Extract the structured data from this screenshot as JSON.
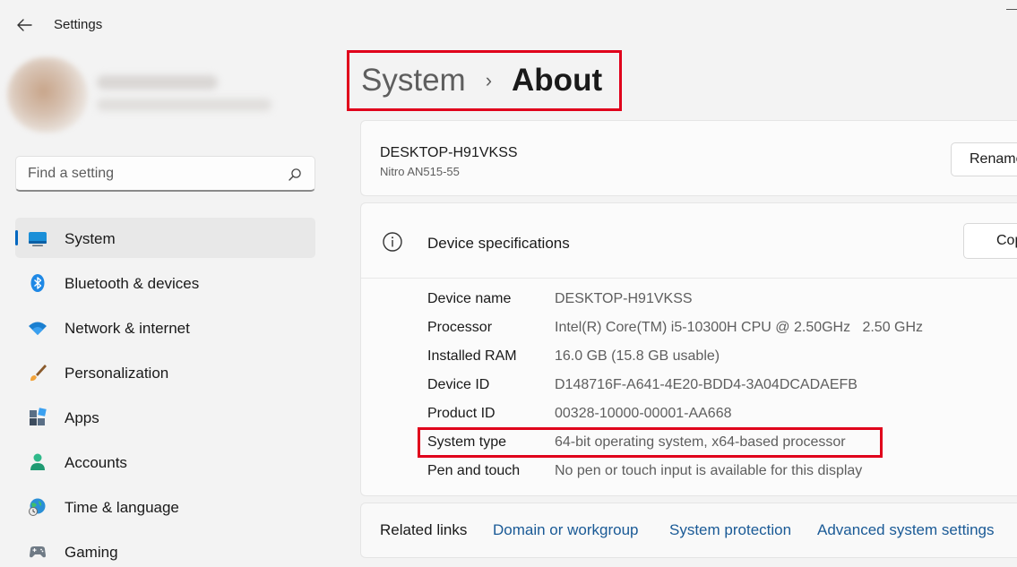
{
  "window": {
    "title": "Settings"
  },
  "search": {
    "placeholder": "Find a setting"
  },
  "nav": {
    "items": [
      {
        "label": "System"
      },
      {
        "label": "Bluetooth & devices"
      },
      {
        "label": "Network & internet"
      },
      {
        "label": "Personalization"
      },
      {
        "label": "Apps"
      },
      {
        "label": "Accounts"
      },
      {
        "label": "Time & language"
      },
      {
        "label": "Gaming"
      }
    ]
  },
  "breadcrumb": {
    "parent": "System",
    "separator": "›",
    "current": "About"
  },
  "device": {
    "name": "DESKTOP-H91VKSS",
    "model": "Nitro AN515-55",
    "rename_label": "Rename"
  },
  "specs": {
    "title": "Device specifications",
    "copy_label": "Copy",
    "rows": [
      {
        "key": "Device name",
        "value": "DESKTOP-H91VKSS"
      },
      {
        "key": "Processor",
        "value": "Intel(R) Core(TM) i5-10300H CPU @ 2.50GHz   2.50 GHz"
      },
      {
        "key": "Installed RAM",
        "value": "16.0 GB (15.8 GB usable)"
      },
      {
        "key": "Device ID",
        "value": "D148716F-A641-4E20-BDD4-3A04DCADAEFB"
      },
      {
        "key": "Product ID",
        "value": "00328-10000-00001-AA668"
      },
      {
        "key": "System type",
        "value": "64-bit operating system, x64-based processor"
      },
      {
        "key": "Pen and touch",
        "value": "No pen or touch input is available for this display"
      }
    ]
  },
  "related": {
    "title": "Related links",
    "links": [
      "Domain or workgroup",
      "System protection",
      "Advanced system settings"
    ]
  },
  "colors": {
    "accent": "#0067c0",
    "highlight": "#e0001b"
  }
}
